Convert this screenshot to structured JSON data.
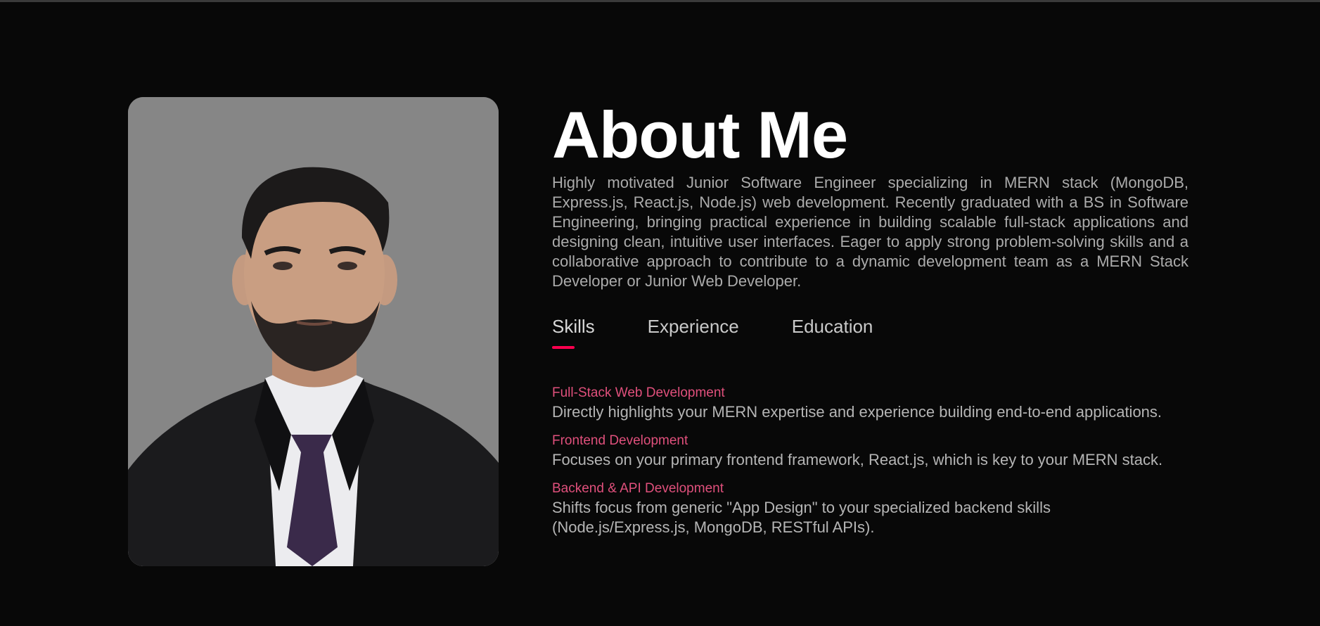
{
  "about": {
    "title": "About Me",
    "bio": "Highly motivated Junior Software Engineer specializing in MERN stack (MongoDB, Express.js, React.js, Node.js) web development. Recently graduated with a BS in Software Engineering, bringing practical experience in building scalable full-stack applications and designing clean, intuitive user interfaces. Eager to apply strong problem-solving skills and a collaborative approach to contribute to a dynamic development team as a MERN Stack Developer or Junior Web Developer.",
    "tabs": [
      {
        "label": "Skills",
        "active": true
      },
      {
        "label": "Experience",
        "active": false
      },
      {
        "label": "Education",
        "active": false
      }
    ],
    "skills": [
      {
        "title": "Full-Stack Web Development",
        "desc": "Directly highlights your MERN expertise and experience building end-to-end applications."
      },
      {
        "title": "Frontend Development",
        "desc": "Focuses on your primary frontend framework, React.js, which is key to your MERN stack."
      },
      {
        "title": "Backend & API Development",
        "desc": "Shifts focus from generic \"App Design\" to your specialized backend skills (Node.js/Express.js, MongoDB, RESTful APIs)."
      }
    ]
  },
  "colors": {
    "background": "#080808",
    "accent": "#ff004f",
    "skill_title": "#e0507c",
    "body_text": "#ababab",
    "photo_bg": "#868686"
  }
}
